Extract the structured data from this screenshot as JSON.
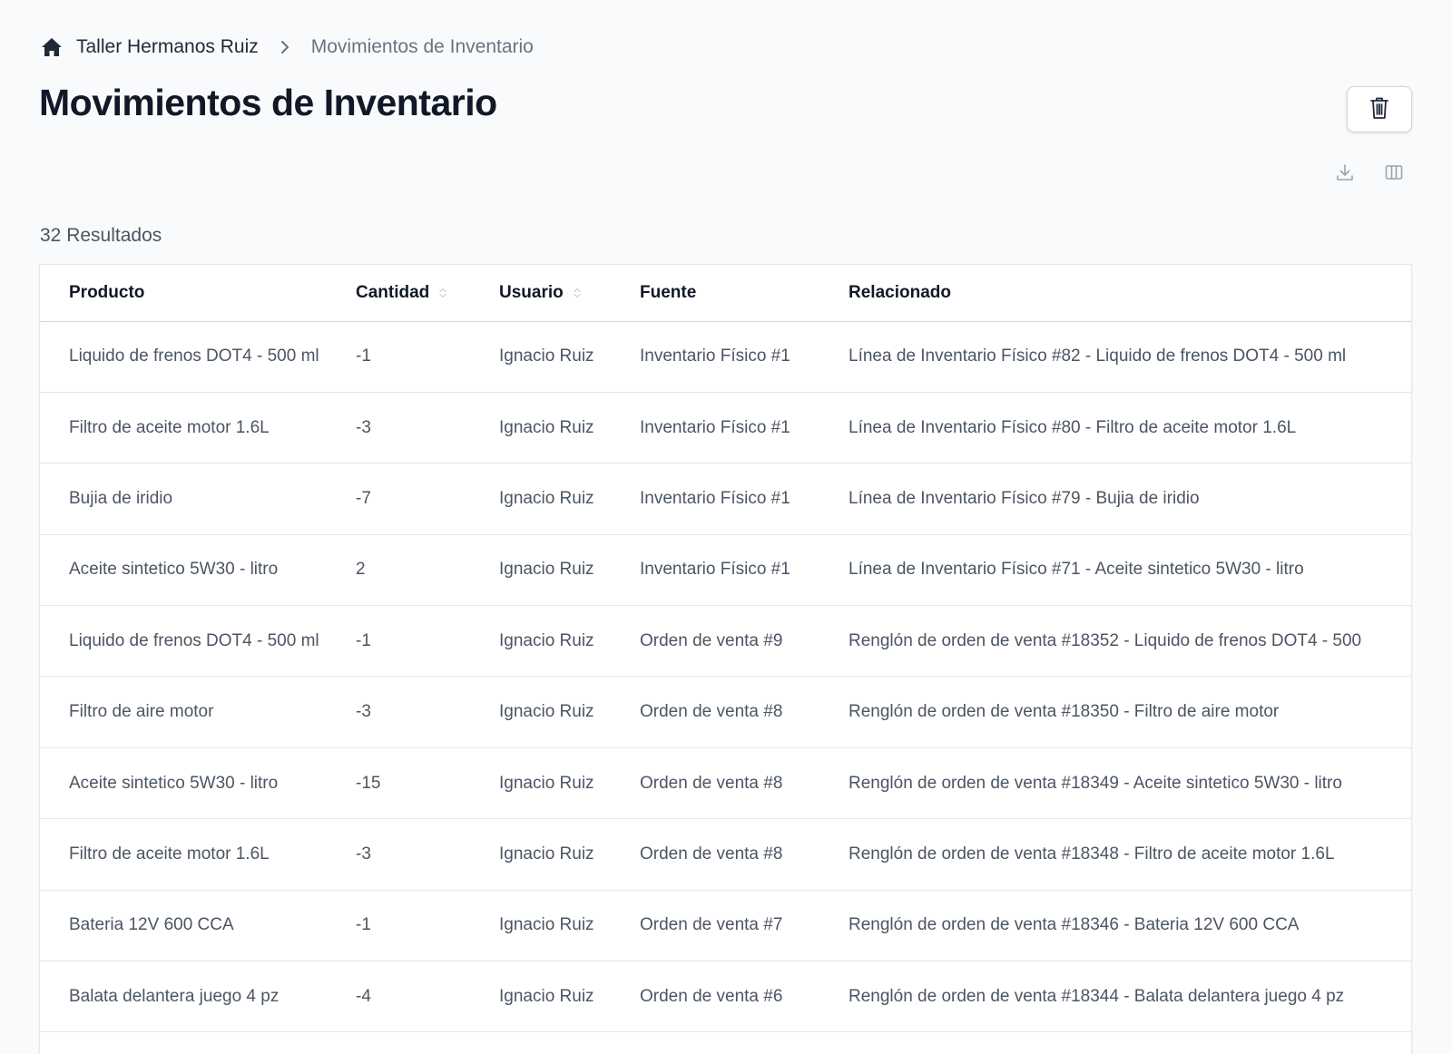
{
  "breadcrumb": {
    "home_icon": "home-icon",
    "workspace": "Taller Hermanos Ruiz",
    "separator_icon": "chevron-right-icon",
    "current": "Movimientos de Inventario"
  },
  "header": {
    "title": "Movimientos de Inventario",
    "delete_icon": "trash-icon"
  },
  "toolbar": {
    "download_icon": "download-icon",
    "columns_icon": "columns-icon"
  },
  "results": {
    "count_label": "32 Resultados"
  },
  "table": {
    "columns": [
      {
        "label": "Producto",
        "sortable": false
      },
      {
        "label": "Cantidad",
        "sortable": true
      },
      {
        "label": "Usuario",
        "sortable": true
      },
      {
        "label": "Fuente",
        "sortable": false
      },
      {
        "label": "Relacionado",
        "sortable": false
      }
    ],
    "rows": [
      [
        "Liquido de frenos DOT4 - 500 ml",
        "-1",
        "Ignacio Ruiz",
        "Inventario Físico #1",
        "Línea de Inventario Físico #82 - Liquido de frenos DOT4 - 500 ml"
      ],
      [
        "Filtro de aceite motor 1.6L",
        "-3",
        "Ignacio Ruiz",
        "Inventario Físico #1",
        "Línea de Inventario Físico #80 - Filtro de aceite motor 1.6L"
      ],
      [
        "Bujia de iridio",
        "-7",
        "Ignacio Ruiz",
        "Inventario Físico #1",
        "Línea de Inventario Físico #79 - Bujia de iridio"
      ],
      [
        "Aceite sintetico 5W30 - litro",
        "2",
        "Ignacio Ruiz",
        "Inventario Físico #1",
        "Línea de Inventario Físico #71 - Aceite sintetico 5W30 - litro"
      ],
      [
        "Liquido de frenos DOT4 - 500 ml",
        "-1",
        "Ignacio Ruiz",
        "Orden de venta #9",
        "Renglón de orden de venta #18352 - Liquido de frenos DOT4 - 500"
      ],
      [
        "Filtro de aire motor",
        "-3",
        "Ignacio Ruiz",
        "Orden de venta #8",
        "Renglón de orden de venta #18350 - Filtro de aire motor"
      ],
      [
        "Aceite sintetico 5W30 - litro",
        "-15",
        "Ignacio Ruiz",
        "Orden de venta #8",
        "Renglón de orden de venta #18349 - Aceite sintetico 5W30 - litro"
      ],
      [
        "Filtro de aceite motor 1.6L",
        "-3",
        "Ignacio Ruiz",
        "Orden de venta #8",
        "Renglón de orden de venta #18348 - Filtro de aceite motor 1.6L"
      ],
      [
        "Bateria 12V 600 CCA",
        "-1",
        "Ignacio Ruiz",
        "Orden de venta #7",
        "Renglón de orden de venta #18346 - Bateria 12V 600 CCA"
      ],
      [
        "Balata delantera juego 4 pz",
        "-4",
        "Ignacio Ruiz",
        "Orden de venta #6",
        "Renglón de orden de venta #18344 - Balata delantera juego 4 pz"
      ]
    ]
  },
  "colors": {
    "background": "#f9fafb",
    "title": "#111827",
    "muted_text": "#4b5563",
    "border": "#e5e7eb"
  }
}
